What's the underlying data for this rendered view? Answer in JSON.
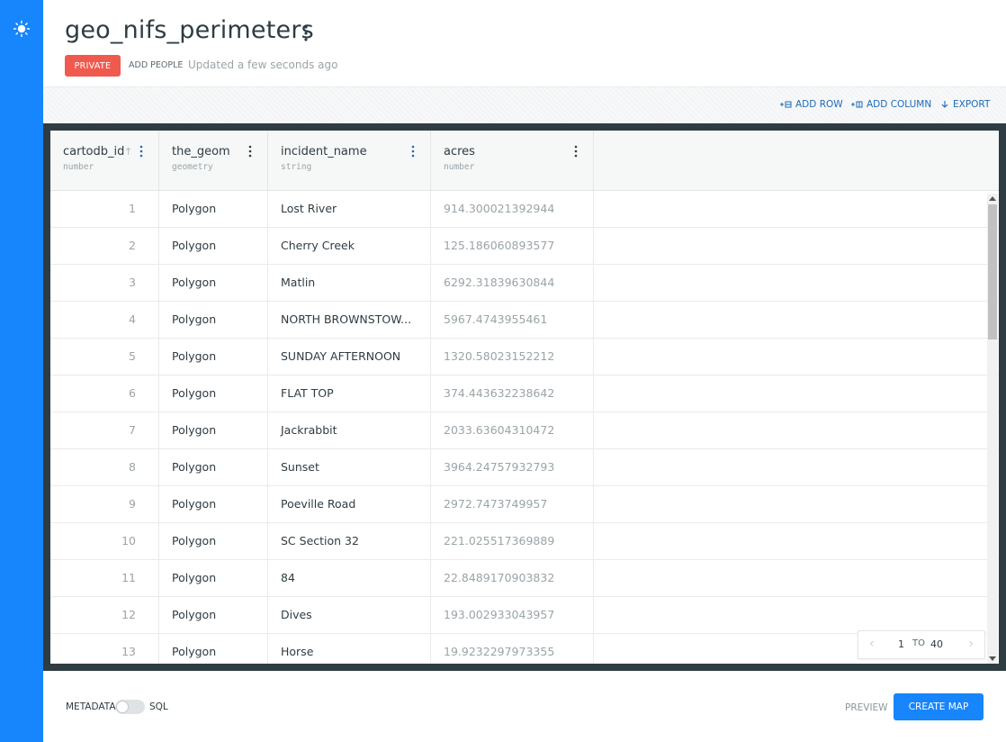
{
  "header": {
    "title": "geo_nifs_perimeters",
    "privacy_label": "PRIVATE",
    "add_people_label": "ADD PEOPLE",
    "updated_text": "Updated a few seconds ago"
  },
  "toolbar": {
    "add_row_label": "ADD ROW",
    "add_column_label": "ADD COLUMN",
    "export_label": "EXPORT"
  },
  "table": {
    "columns": [
      {
        "name": "cartodb_id",
        "type": "number"
      },
      {
        "name": "the_geom",
        "type": "geometry"
      },
      {
        "name": "incident_name",
        "type": "string"
      },
      {
        "name": "acres",
        "type": "number"
      }
    ],
    "rows": [
      {
        "cartodb_id": "1",
        "the_geom": "Polygon",
        "incident_name": "Lost River",
        "acres": "914.300021392944"
      },
      {
        "cartodb_id": "2",
        "the_geom": "Polygon",
        "incident_name": "Cherry Creek",
        "acres": "125.186060893577"
      },
      {
        "cartodb_id": "3",
        "the_geom": "Polygon",
        "incident_name": "Matlin",
        "acres": "6292.31839630844"
      },
      {
        "cartodb_id": "4",
        "the_geom": "Polygon",
        "incident_name": "NORTH BROWNSTOW...",
        "acres": "5967.4743955461"
      },
      {
        "cartodb_id": "5",
        "the_geom": "Polygon",
        "incident_name": "SUNDAY AFTERNOON",
        "acres": "1320.58023152212"
      },
      {
        "cartodb_id": "6",
        "the_geom": "Polygon",
        "incident_name": "FLAT TOP",
        "acres": "374.443632238642"
      },
      {
        "cartodb_id": "7",
        "the_geom": "Polygon",
        "incident_name": "Jackrabbit",
        "acres": "2033.63604310472"
      },
      {
        "cartodb_id": "8",
        "the_geom": "Polygon",
        "incident_name": "Sunset",
        "acres": "3964.24757932793"
      },
      {
        "cartodb_id": "9",
        "the_geom": "Polygon",
        "incident_name": "Poeville Road",
        "acres": "2972.7473749957"
      },
      {
        "cartodb_id": "10",
        "the_geom": "Polygon",
        "incident_name": "SC Section 32",
        "acres": "221.025517369889"
      },
      {
        "cartodb_id": "11",
        "the_geom": "Polygon",
        "incident_name": "84",
        "acres": "22.8489170903832"
      },
      {
        "cartodb_id": "12",
        "the_geom": "Polygon",
        "incident_name": "Dives",
        "acres": "193.002933043957"
      },
      {
        "cartodb_id": "13",
        "the_geom": "Polygon",
        "incident_name": "Horse",
        "acres": "19.9232297973355"
      }
    ]
  },
  "pagination": {
    "from": "1",
    "to_label": "TO",
    "total": "40"
  },
  "footer": {
    "metadata_label": "METADATA",
    "sql_label": "SQL",
    "preview_label": "PREVIEW",
    "create_map_label": "CREATE MAP"
  },
  "colors": {
    "brand_blue": "#1785fb",
    "private_red": "#f05a4e",
    "frame_dark": "#2e3c43"
  }
}
